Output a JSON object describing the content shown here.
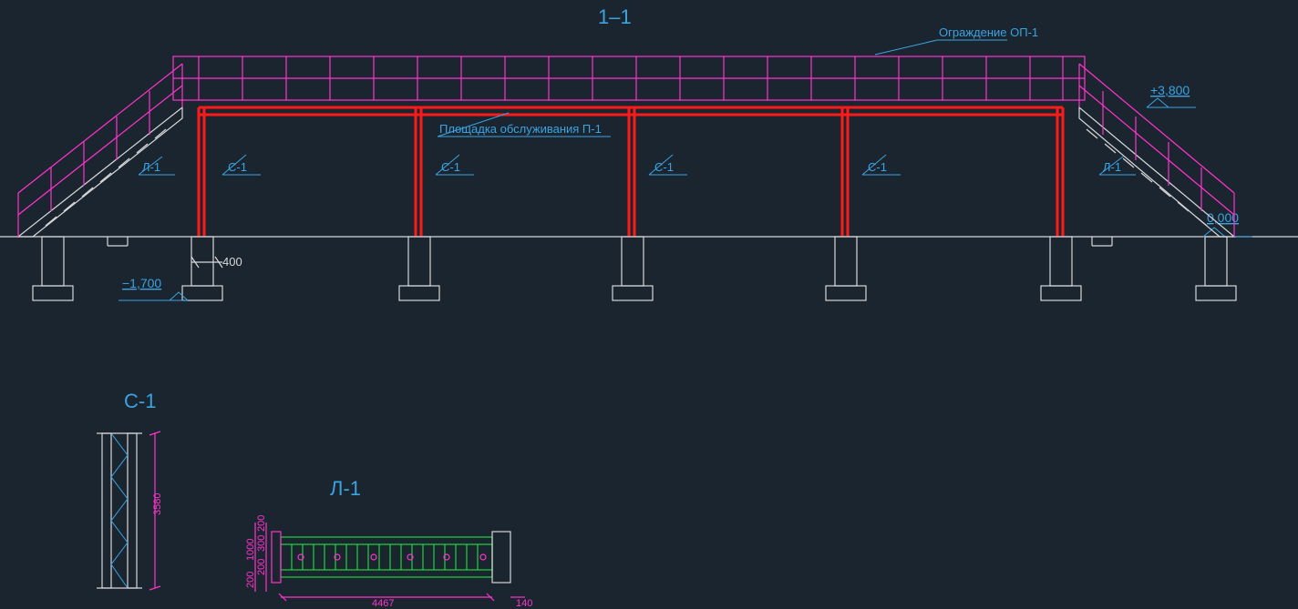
{
  "section": {
    "title": "1–1",
    "fence_label": "Ограждение ОП-1",
    "platform_label": "Площадка обслуживания П-1",
    "column_label": "С-1",
    "stair_label": "Л-1",
    "elev_top": "+3,800",
    "elev_ground": "0,000",
    "elev_foot": "−1,700",
    "dim_400": "400"
  },
  "detail_c": {
    "title": "С-1",
    "height": "3580"
  },
  "detail_l": {
    "title": "Л-1",
    "d_200a": "200",
    "d_300": "300",
    "d_200b": "200",
    "d_1000": "1000",
    "d_200c": "200",
    "d_len": "4467",
    "d_140": "140"
  }
}
